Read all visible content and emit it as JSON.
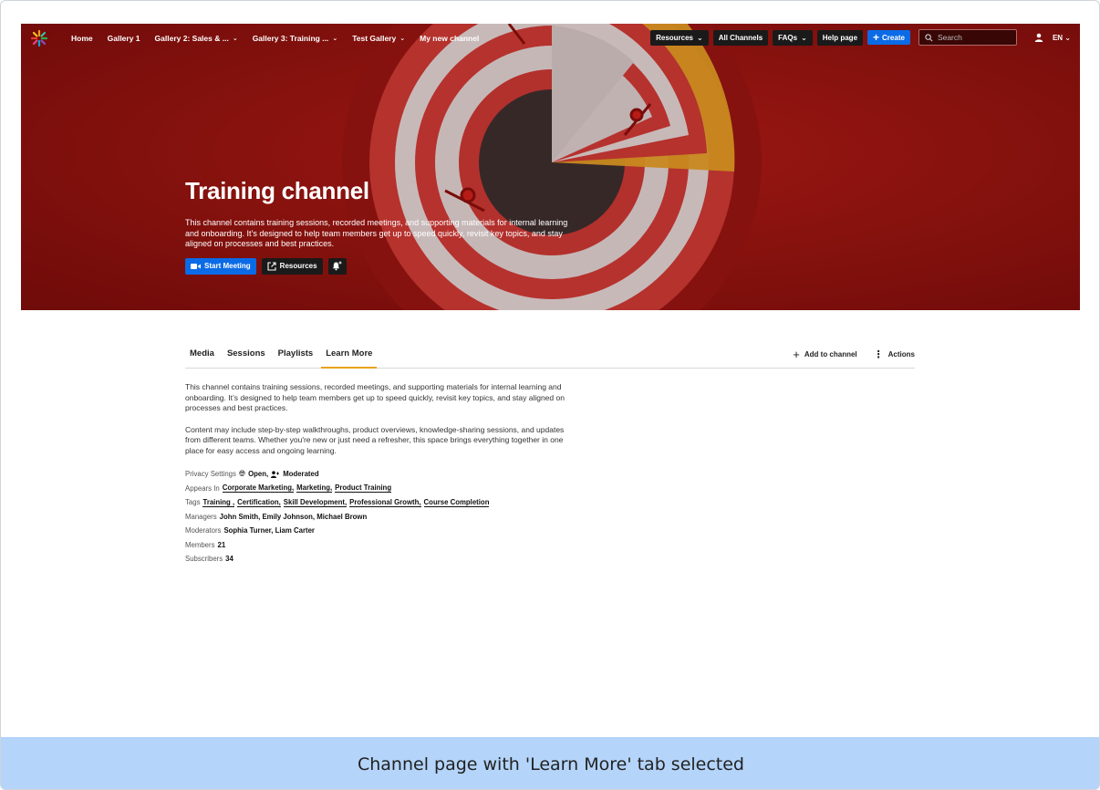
{
  "nav": {
    "items": [
      {
        "label": "Home",
        "has_dropdown": false
      },
      {
        "label": "Gallery 1",
        "has_dropdown": false
      },
      {
        "label": "Gallery 2: Sales & ...",
        "has_dropdown": true
      },
      {
        "label": "Gallery 3: Training ...",
        "has_dropdown": true
      },
      {
        "label": "Test Gallery",
        "has_dropdown": true
      },
      {
        "label": "My new channel",
        "has_dropdown": false
      }
    ],
    "resources_label": "Resources",
    "all_channels_label": "All Channels",
    "faqs_label": "FAQs",
    "help_label": "Help page",
    "create_label": "Create",
    "search_placeholder": "Search",
    "language": "EN"
  },
  "hero": {
    "title": "Training channel",
    "description": "This channel contains training sessions, recorded meetings, and supporting materials for internal learning and onboarding. It’s designed to help team members get up to speed quickly, revisit key topics, and stay aligned on processes and best practices.",
    "start_meeting_label": "Start Meeting",
    "resources_label": "Resources"
  },
  "tabs": {
    "items": [
      "Media",
      "Sessions",
      "Playlists",
      "Learn More"
    ],
    "active": "Learn More",
    "add_to_channel_label": "Add to channel",
    "actions_label": "Actions"
  },
  "about": {
    "paragraph1": "This channel contains training sessions, recorded meetings, and supporting materials for internal learning and onboarding. It’s designed to help team members get up to speed quickly, revisit key topics, and stay aligned on processes and best practices.",
    "paragraph2": "Content may include step-by-step walkthroughs, product overviews, knowledge-sharing sessions, and updates from different teams. Whether you're new or just need a refresher, this space brings everything together in one place for easy access and ongoing learning."
  },
  "meta": {
    "privacy_label": "Privacy Settings",
    "privacy_open": "Open,",
    "privacy_moderated": "Moderated",
    "appears_in_label": "Appears In",
    "appears_in": [
      "Corporate Marketing,",
      "Marketing,",
      "Product Training"
    ],
    "tags_label": "Tags",
    "tags": [
      "Training ,",
      "Certification,",
      "Skill Development,",
      "Professional Growth,",
      "Course Completion"
    ],
    "managers_label": "Managers",
    "managers": "John Smith, Emily Johnson, Michael Brown",
    "moderators_label": "Moderators",
    "moderators": "Sophia Turner, Liam Carter",
    "members_label": "Members",
    "members": "21",
    "subscribers_label": "Subscribers",
    "subscribers": "34"
  },
  "caption": "Channel page with 'Learn More' tab selected",
  "colors": {
    "hero_red": "#8e1410",
    "accent_blue": "#0b6be6",
    "tab_underline": "#e8a317",
    "caption_bg": "#b4d4fa"
  }
}
